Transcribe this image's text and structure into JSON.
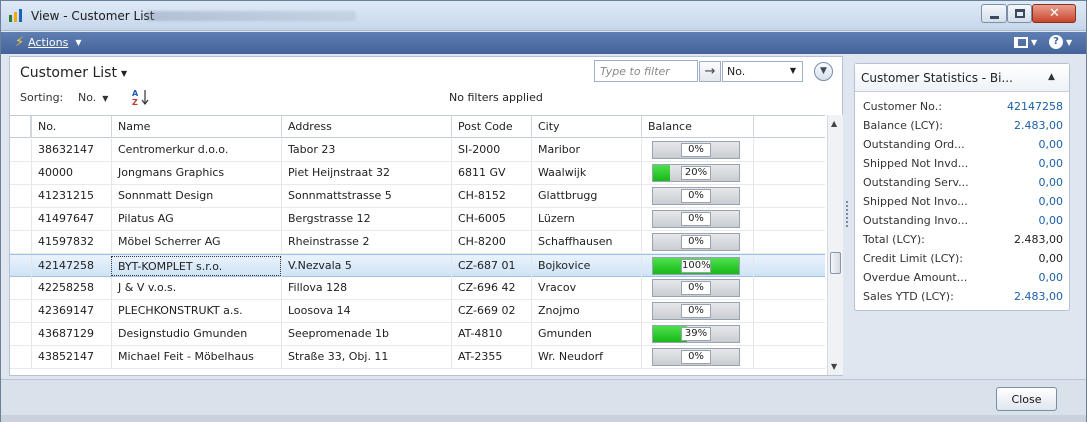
{
  "window": {
    "title": "View - Customer List",
    "minimize_label": "",
    "maximize_label": "",
    "close_glyph": "✕"
  },
  "actionbar": {
    "actions_label": "Actions",
    "help_glyph": "?"
  },
  "list": {
    "title": "Customer List",
    "sorting_label": "Sorting:",
    "sort_value": "No.",
    "az_glyph": "A↓Z",
    "filters_text": "No filters applied",
    "filter_placeholder": "Type to filter",
    "filter_field": "No.",
    "go_glyph": "→",
    "expand_glyph": "⌄"
  },
  "grid": {
    "columns": [
      "No.",
      "Name",
      "Address",
      "Post Code",
      "City",
      "Balance"
    ],
    "rows": [
      {
        "no": "38632147",
        "name": "Centromerkur d.o.o.",
        "address": "Tabor 23",
        "post_code": "SI-2000",
        "city": "Maribor",
        "balance_pct": 0,
        "balance_label": "0%"
      },
      {
        "no": "40000",
        "name": "Jongmans Graphics",
        "address": "Piet Heijnstraat 32",
        "post_code": "6811 GV",
        "city": "Waalwijk",
        "balance_pct": 20,
        "balance_label": "20%"
      },
      {
        "no": "41231215",
        "name": "Sonnmatt Design",
        "address": "Sonnmattstrasse 5",
        "post_code": "CH-8152",
        "city": "Glattbrugg",
        "balance_pct": 0,
        "balance_label": "0%"
      },
      {
        "no": "41497647",
        "name": "Pilatus AG",
        "address": "Bergstrasse 12",
        "post_code": "CH-6005",
        "city": "Lüzern",
        "balance_pct": 0,
        "balance_label": "0%"
      },
      {
        "no": "41597832",
        "name": "Möbel Scherrer AG",
        "address": "Rheinstrasse 2",
        "post_code": "CH-8200",
        "city": "Schaffhausen",
        "balance_pct": 0,
        "balance_label": "0%"
      },
      {
        "no": "42147258",
        "name": "BYT-KOMPLET s.r.o.",
        "address": "V.Nezvala 5",
        "post_code": "CZ-687 01",
        "city": "Bojkovice",
        "balance_pct": 100,
        "balance_label": "100%",
        "selected": true
      },
      {
        "no": "42258258",
        "name": "J & V v.o.s.",
        "address": "Fillova 128",
        "post_code": "CZ-696 42",
        "city": "Vracov",
        "balance_pct": 0,
        "balance_label": "0%"
      },
      {
        "no": "42369147",
        "name": "PLECHKONSTRUKT a.s.",
        "address": "Loosova 14",
        "post_code": "CZ-669 02",
        "city": "Znojmo",
        "balance_pct": 0,
        "balance_label": "0%"
      },
      {
        "no": "43687129",
        "name": "Designstudio Gmunden",
        "address": "Seepromenade 1b",
        "post_code": "AT-4810",
        "city": "Gmunden",
        "balance_pct": 39,
        "balance_label": "39%"
      },
      {
        "no": "43852147",
        "name": "Michael Feit - Möbelhaus",
        "address": "Straße 33, Obj. 11",
        "post_code": "AT-2355",
        "city": "Wr. Neudorf",
        "balance_pct": 0,
        "balance_label": "0%"
      }
    ]
  },
  "factbox": {
    "title": "Customer Statistics - Bi...",
    "collapse_glyph": "▲",
    "fields": [
      {
        "label": "Customer No.:",
        "value": "42147258",
        "link": true
      },
      {
        "label": "Balance (LCY):",
        "value": "2.483,00",
        "link": true
      },
      {
        "label": "Outstanding Ord...",
        "value": "0,00",
        "link": true
      },
      {
        "label": "Shipped Not Invd...",
        "value": "0,00",
        "link": true
      },
      {
        "label": "Outstanding Serv...",
        "value": "0,00",
        "link": true
      },
      {
        "label": "Shipped Not Invo...",
        "value": "0,00",
        "link": true
      },
      {
        "label": "Outstanding Invo...",
        "value": "0,00",
        "link": true
      },
      {
        "label": "Total (LCY):",
        "value": "2.483,00",
        "link": false
      },
      {
        "label": "Credit Limit (LCY):",
        "value": "0,00",
        "link": false
      },
      {
        "label": "Overdue Amount...",
        "value": "0,00",
        "link": true
      },
      {
        "label": "Sales YTD (LCY):",
        "value": "2.483,00",
        "link": true
      }
    ]
  },
  "footer": {
    "close_label": "Close"
  },
  "colors": {
    "actionbar": "#44639a",
    "progress_green": "#18b818",
    "link": "#1c5fa8",
    "selection": "#cfe3f7"
  },
  "icons": [
    "app-icon",
    "lightning-icon",
    "chevron-down-icon",
    "sort-az-icon",
    "arrow-right-icon",
    "expand-circle-icon",
    "layout-icon",
    "help-icon",
    "collapse-icon"
  ]
}
